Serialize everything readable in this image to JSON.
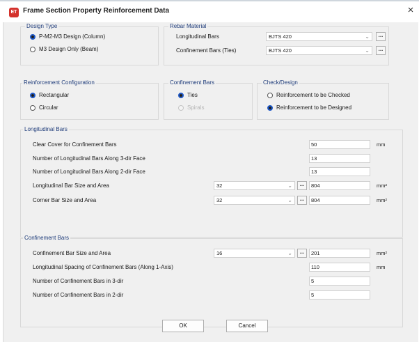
{
  "window": {
    "title": "Frame Section Property Reinforcement Data",
    "icon_text": "ET",
    "close_glyph": "×"
  },
  "design_type": {
    "legend": "Design Type",
    "options": [
      {
        "label": "P-M2-M3 Design  (Column)",
        "selected": true
      },
      {
        "label": "M3 Design Only  (Beam)",
        "selected": false
      }
    ]
  },
  "rebar_material": {
    "legend": "Rebar Material",
    "longitudinal_label": "Longitudinal Bars",
    "longitudinal_value": "BJTS 420",
    "confinement_label": "Confinement Bars (Ties)",
    "confinement_value": "BJTS 420"
  },
  "reinforcement_configuration": {
    "legend": "Reinforcement Configuration",
    "options": [
      {
        "label": "Rectangular",
        "selected": true
      },
      {
        "label": "Circular",
        "selected": false
      }
    ]
  },
  "confinement_bars_type": {
    "legend": "Confinement Bars",
    "options": [
      {
        "label": "Ties",
        "selected": true
      },
      {
        "label": "Spirals",
        "selected": false,
        "disabled": true
      }
    ]
  },
  "check_design": {
    "legend": "Check/Design",
    "options": [
      {
        "label": "Reinforcement to be Checked",
        "selected": false
      },
      {
        "label": "Reinforcement to be Designed",
        "selected": true
      }
    ]
  },
  "longitudinal_bars": {
    "legend": "Longitudinal Bars",
    "clear_cover_label": "Clear Cover for Confinement Bars",
    "clear_cover_value": "50",
    "clear_cover_unit": "mm",
    "num_3dir_label": "Number of Longitudinal Bars Along 3-dir Face",
    "num_3dir_value": "13",
    "num_2dir_label": "Number of Longitudinal Bars Along 2-dir Face",
    "num_2dir_value": "13",
    "bar_size_label": "Longitudinal Bar Size and Area",
    "bar_size_value": "32",
    "bar_area_value": "804",
    "bar_area_unit": "mm²",
    "corner_label": "Corner Bar Size and Area",
    "corner_size_value": "32",
    "corner_area_value": "804",
    "corner_area_unit": "mm²"
  },
  "confinement_bars": {
    "legend": "Confinement Bars",
    "bar_size_label": "Confinement Bar Size and Area",
    "bar_size_value": "16",
    "bar_area_value": "201",
    "bar_area_unit": "mm²",
    "spacing_label": "Longitudinal Spacing of Confinement Bars  (Along 1-Axis)",
    "spacing_value": "110",
    "spacing_unit": "mm",
    "num_3dir_label": "Number of Confinement Bars in 3-dir",
    "num_3dir_value": "5",
    "num_2dir_label": "Number of Confinement Bars in 2-dir",
    "num_2dir_value": "5"
  },
  "buttons": {
    "ok": "OK",
    "cancel": "Cancel"
  },
  "glyphs": {
    "dots": "...",
    "dropdown_arrow": "⌄"
  }
}
